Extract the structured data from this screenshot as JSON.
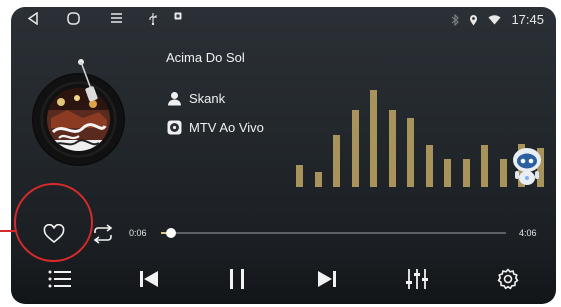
{
  "status_bar": {
    "time": "17:45",
    "left_icons": [
      "back-triangle-icon",
      "home-circle-icon",
      "menu-lines-icon",
      "usb-icon",
      "square-dot-icon"
    ],
    "right_icons": [
      "bluetooth-icon",
      "location-icon",
      "wifi-icon"
    ]
  },
  "track": {
    "title": "Acima Do Sol",
    "artist": "Skank",
    "album": "MTV Ao Vivo"
  },
  "progress": {
    "current": "0:06",
    "total": "4:06",
    "fraction": 0.03
  },
  "equalizer": {
    "color": "#a8935c",
    "levels": [
      0.16,
      0.11,
      0.37,
      0.55,
      0.69,
      0.55,
      0.49,
      0.3,
      0.2,
      0.2,
      0.3,
      0.2,
      0.31,
      0.28
    ]
  },
  "controls": [
    "playlist-icon",
    "previous-icon",
    "pause-icon",
    "next-icon",
    "equalizer-settings-icon",
    "gear-icon"
  ],
  "annotation": {
    "color": "#d82a2a"
  }
}
